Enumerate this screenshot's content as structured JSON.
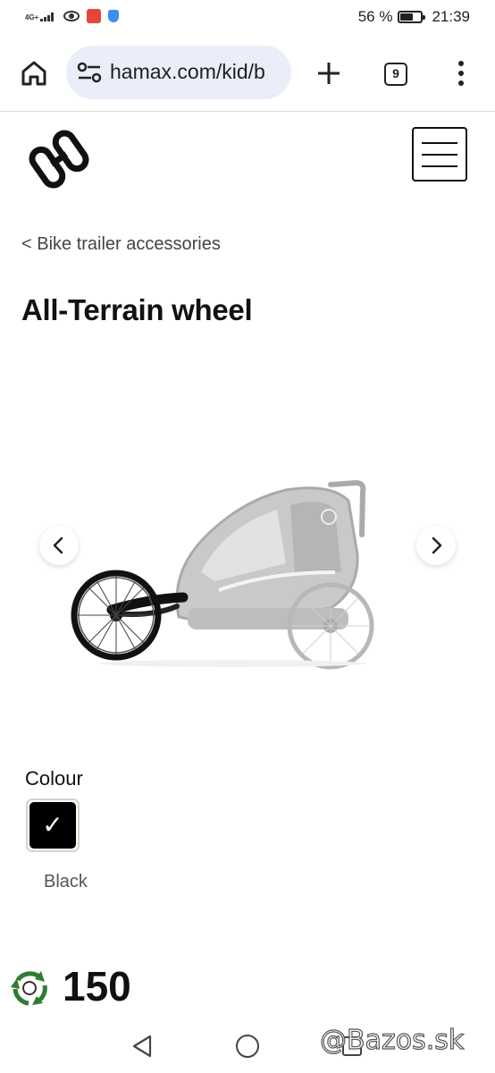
{
  "status_bar": {
    "network": "4G+",
    "battery_text": "56 %",
    "time": "21:39",
    "icons": [
      "signal-icon",
      "eye-icon",
      "app-notification-icon",
      "shield-icon",
      "battery-icon"
    ],
    "battery_level": 0.56
  },
  "browser": {
    "url": "hamax.com/kid/b",
    "tab_count": "9",
    "icons": [
      "home-icon",
      "site-settings-icon",
      "new-tab-icon",
      "tabs-icon",
      "more-menu-icon"
    ]
  },
  "site": {
    "logo_icon": "hamax-logo-icon",
    "menu_icon": "hamburger-menu-icon"
  },
  "page": {
    "breadcrumb": "< Bike trailer accessories",
    "title": "All-Terrain wheel"
  },
  "gallery": {
    "image_subject": "trailer-with-jogging-wheel-image",
    "prev_icon": "chevron-left-icon",
    "next_icon": "chevron-right-icon"
  },
  "colour": {
    "label": "Colour",
    "selected_mark": "✓",
    "option_name": "Black",
    "swatch_color": "#000000"
  },
  "eco": {
    "icon": "recycle-icon",
    "value": "150"
  },
  "system_nav": {
    "icons": [
      "back-icon",
      "home-circle-icon",
      "recents-icon"
    ],
    "watermark": "@Bazos.sk"
  }
}
